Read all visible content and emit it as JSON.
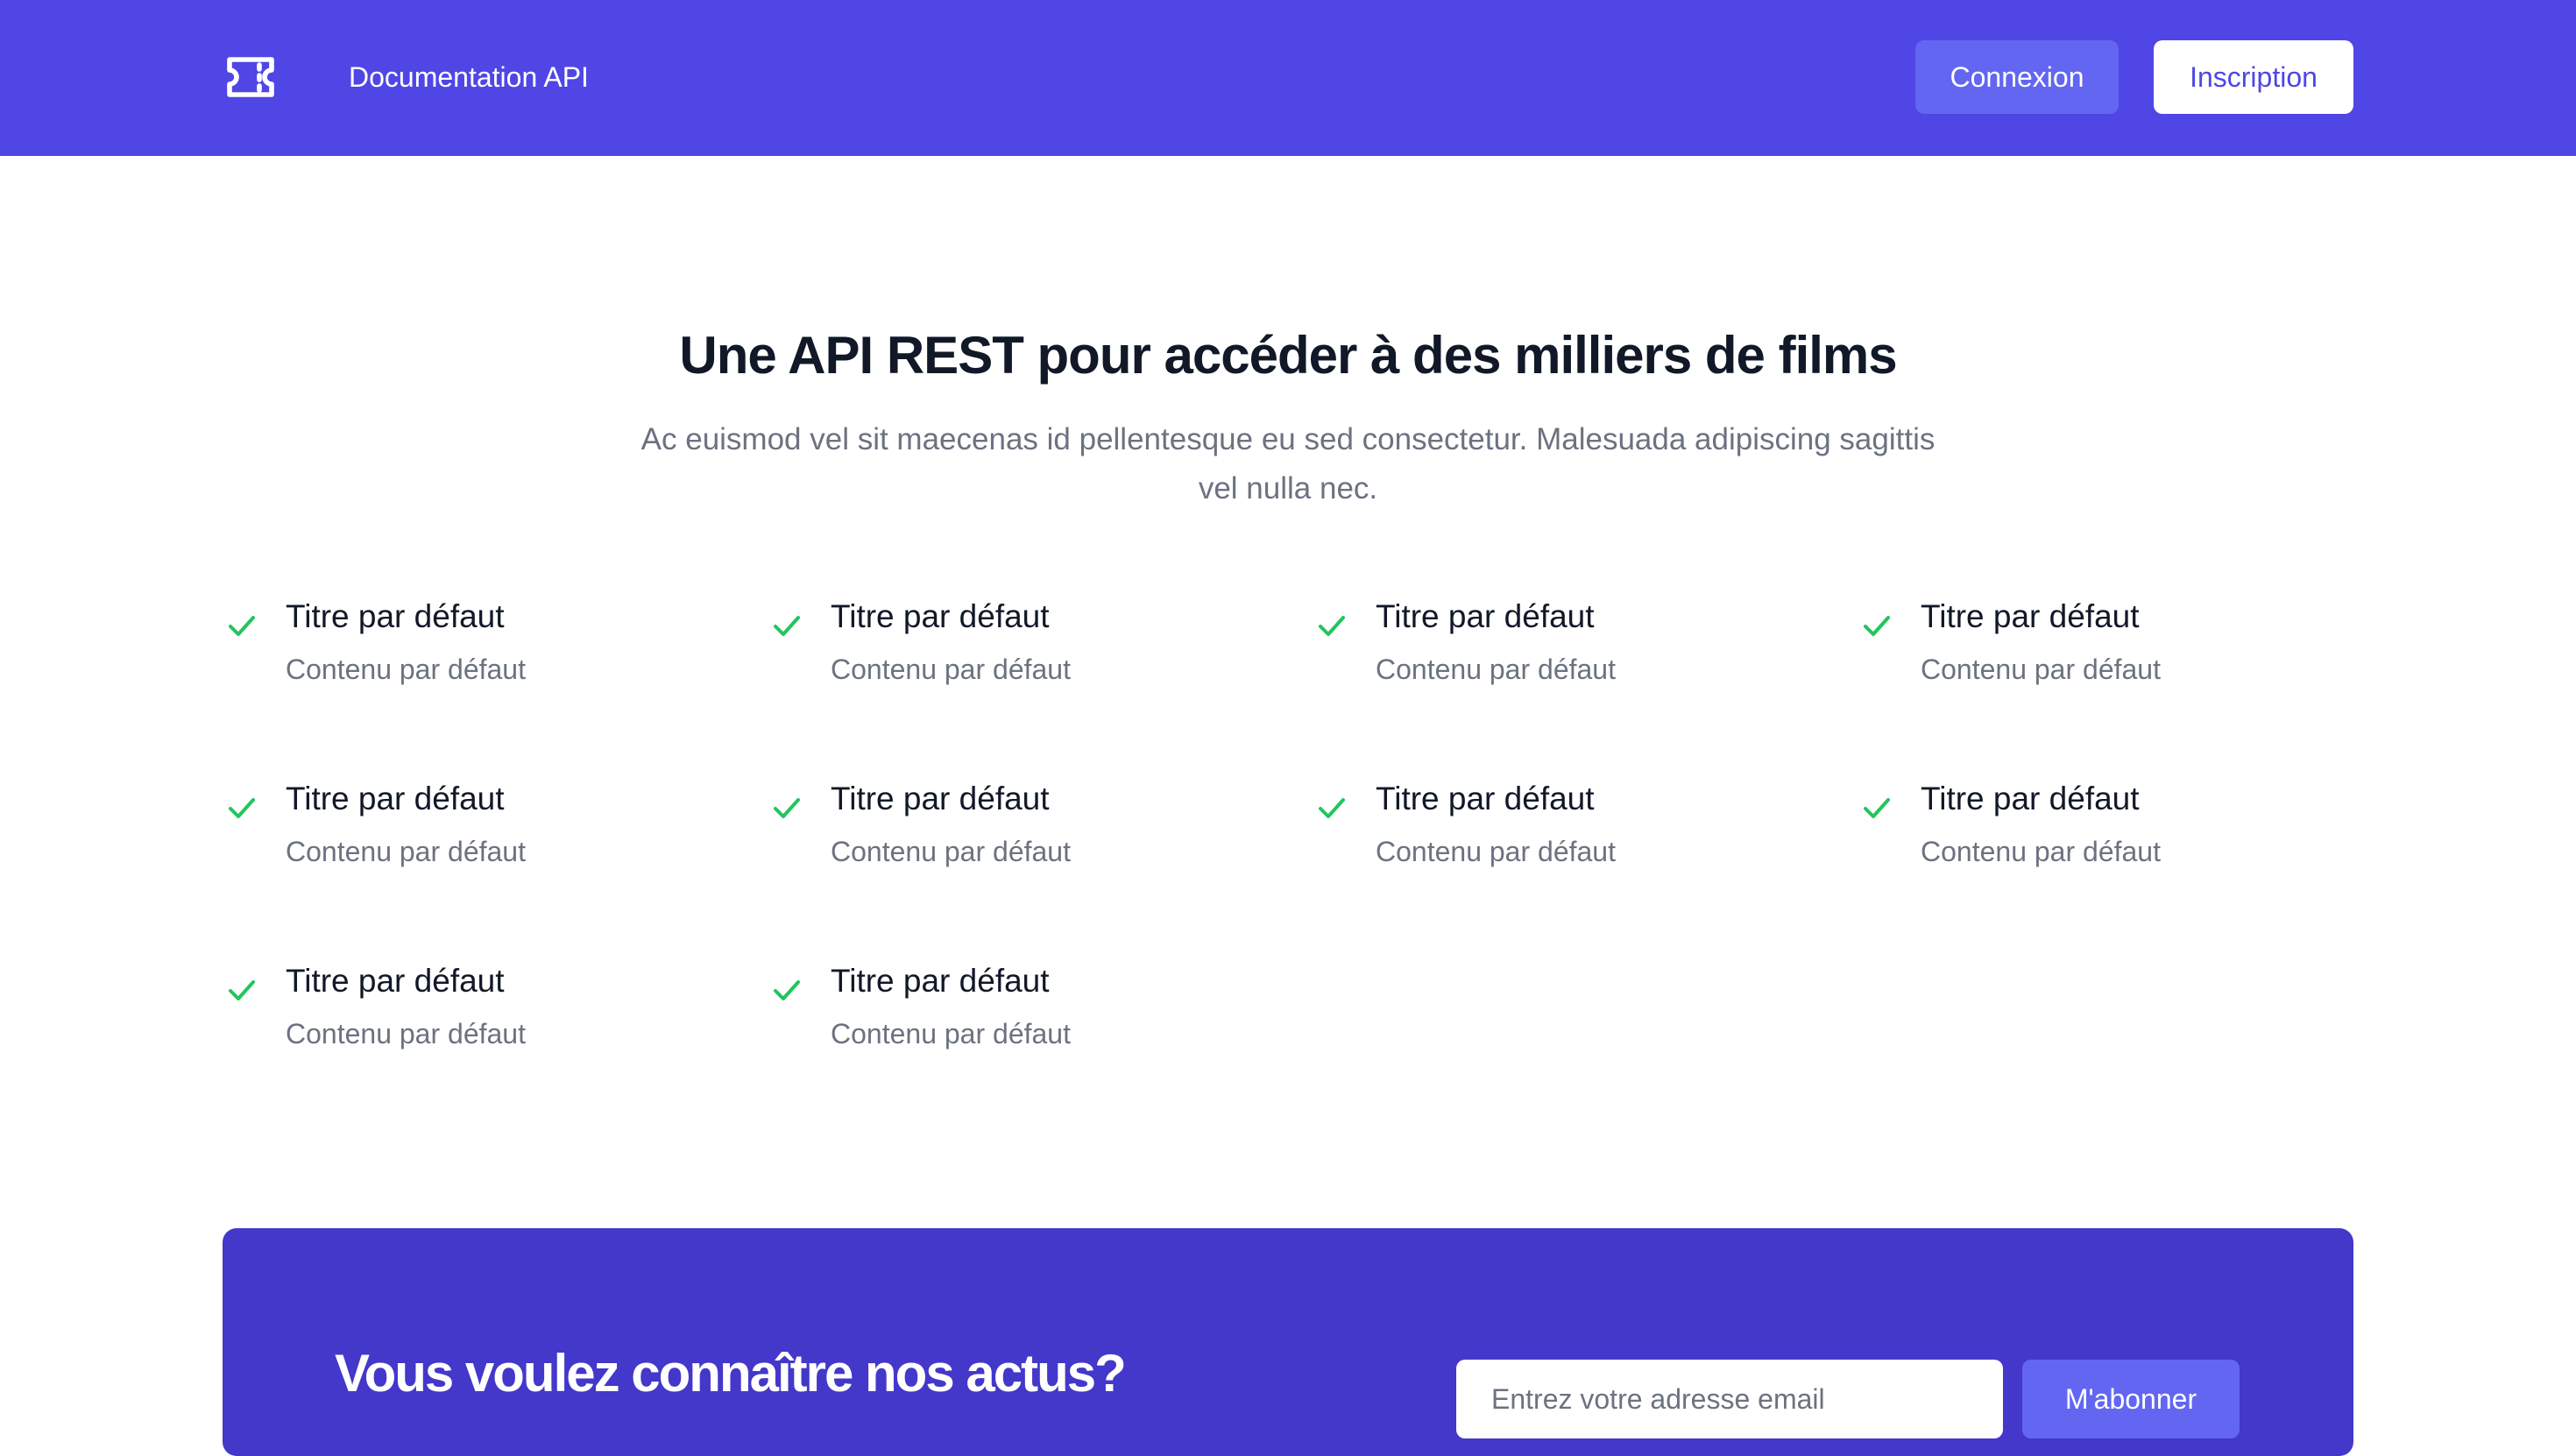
{
  "header": {
    "logo_icon": "ticket-icon",
    "nav_link": "Documentation API",
    "login_label": "Connexion",
    "signup_label": "Inscription"
  },
  "features": {
    "title": "Une API REST pour accéder à des milliers de films",
    "subtitle": "Ac euismod vel sit maecenas id pellentesque eu sed consectetur. Malesuada adipiscing sagittis vel nulla nec.",
    "items": [
      {
        "title": "Titre par défaut",
        "description": "Contenu par défaut"
      },
      {
        "title": "Titre par défaut",
        "description": "Contenu par défaut"
      },
      {
        "title": "Titre par défaut",
        "description": "Contenu par défaut"
      },
      {
        "title": "Titre par défaut",
        "description": "Contenu par défaut"
      },
      {
        "title": "Titre par défaut",
        "description": "Contenu par défaut"
      },
      {
        "title": "Titre par défaut",
        "description": "Contenu par défaut"
      },
      {
        "title": "Titre par défaut",
        "description": "Contenu par défaut"
      },
      {
        "title": "Titre par défaut",
        "description": "Contenu par défaut"
      },
      {
        "title": "Titre par défaut",
        "description": "Contenu par défaut"
      },
      {
        "title": "Titre par défaut",
        "description": "Contenu par défaut"
      }
    ],
    "check_icon": "check-icon"
  },
  "newsletter": {
    "title": "Vous voulez connaître nos actus?",
    "input_placeholder": "Entrez votre adresse email",
    "button_label": "M'abonner"
  },
  "colors": {
    "brand": "#4f46e5",
    "brand_dark": "#4338ca",
    "accent": "#6366f1",
    "check": "#22c55e"
  }
}
